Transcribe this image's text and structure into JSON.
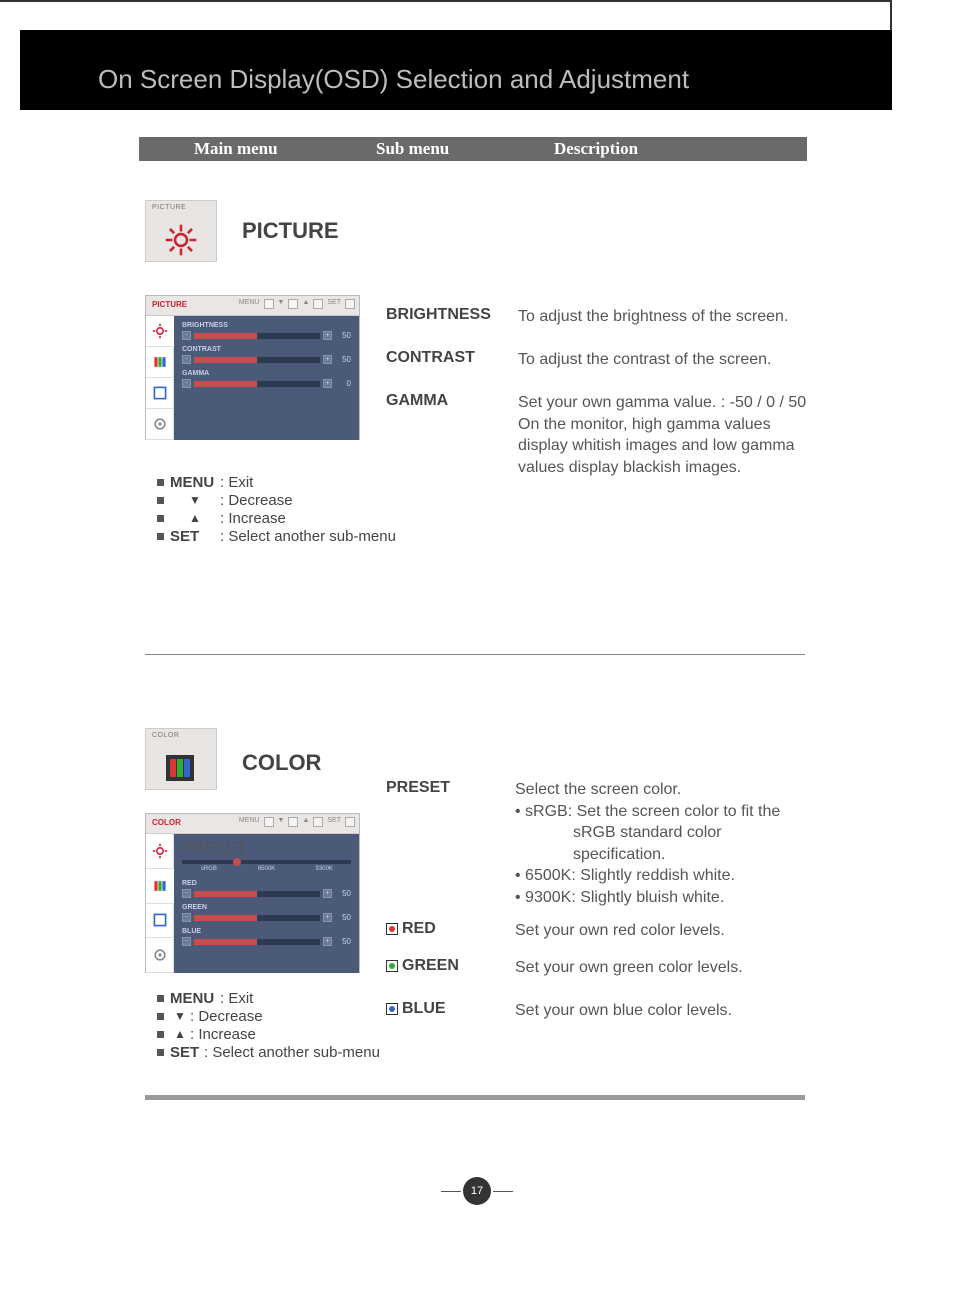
{
  "header": {
    "title": "On Screen Display(OSD) Selection and Adjustment"
  },
  "menu_band": {
    "main": "Main menu",
    "sub": "Sub menu",
    "desc": "Description"
  },
  "picture": {
    "thumb_label": "PICTURE",
    "title": "PICTURE",
    "osd": {
      "title": "PICTURE",
      "nav_menu": "MENU",
      "nav_set": "SET",
      "rows": {
        "brightness": {
          "label": "BRIGHTNESS",
          "value": "50"
        },
        "contrast": {
          "label": "CONTRAST",
          "value": "50"
        },
        "gamma": {
          "label": "GAMMA",
          "value": "0"
        }
      }
    },
    "subs": {
      "brightness": {
        "name": "BRIGHTNESS",
        "desc": "To adjust the brightness of the screen."
      },
      "contrast": {
        "name": "CONTRAST",
        "desc": "To adjust the contrast of the screen."
      },
      "gamma": {
        "name": "GAMMA",
        "desc": "Set your own gamma value. : -50 / 0 / 50 On the monitor, high gamma values display whitish images and low gamma values display blackish images."
      }
    },
    "legend": {
      "menu": "MENU",
      "menu_d": ": Exit",
      "down": "▼",
      "down_d": ": Decrease",
      "up": "▲",
      "up_d": ": Increase",
      "set": "SET",
      "set_d": ": Select another sub-menu"
    }
  },
  "color": {
    "thumb_label": "COLOR",
    "title": "COLOR",
    "osd": {
      "title": "COLOR",
      "nav_menu": "MENU",
      "nav_set": "SET",
      "preset": {
        "label": "PRESET",
        "opts": [
          "sRGB",
          "6500K",
          "9300K"
        ]
      },
      "rows": {
        "red": {
          "label": "RED",
          "value": "50"
        },
        "green": {
          "label": "GREEN",
          "value": "50"
        },
        "blue": {
          "label": "BLUE",
          "value": "50"
        }
      }
    },
    "subs": {
      "preset": {
        "name": "PRESET",
        "intro": "Select the screen color.",
        "b1a": "• sRGB: Set the screen color to fit the",
        "b1b": "sRGB standard color",
        "b1c": "specification.",
        "b2": "• 6500K: Slightly reddish white.",
        "b3": "• 9300K: Slightly bluish white."
      },
      "red": {
        "name": "RED",
        "desc": "Set your own red color levels."
      },
      "green": {
        "name": "GREEN",
        "desc": "Set your own green color levels."
      },
      "blue": {
        "name": "BLUE",
        "desc": "Set your own blue color levels."
      }
    },
    "legend": {
      "menu": "MENU",
      "menu_d": ": Exit",
      "down": "▼",
      "down_d": ": Decrease",
      "up": "▲",
      "up_d": ": Increase",
      "set": "SET",
      "set_d": ": Select another sub-menu"
    }
  },
  "page_number": "17"
}
